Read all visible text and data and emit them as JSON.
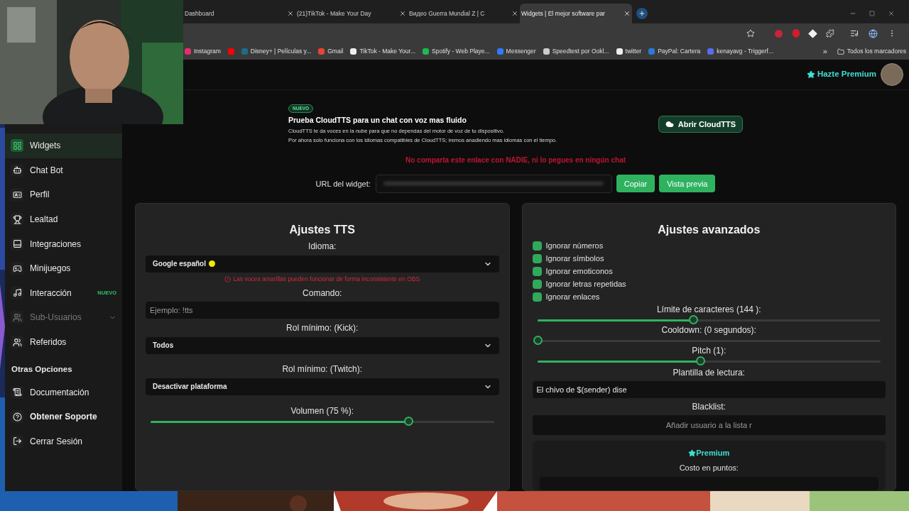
{
  "browser": {
    "tabs": [
      {
        "title": "Dashboard",
        "selected": false
      },
      {
        "title": "(21)TikTok - Make Your Day",
        "selected": false
      },
      {
        "title": "Видео Guerra Mundial Z | С",
        "selected": false
      },
      {
        "title": "Widgets | El mejor software par",
        "selected": true
      }
    ],
    "bookmarks": [
      {
        "label": "Instagram",
        "color": "#e1306c"
      },
      {
        "color": "#ff0000"
      },
      {
        "label": "Disney+ | Películas y...",
        "color": "#1a6e8a"
      },
      {
        "label": "Gmail",
        "color": "#ea4335"
      },
      {
        "label": "TikTok - Make Your...",
        "color": "#eeeeee"
      },
      {
        "label": "Spotify - Web Playe...",
        "color": "#1db954"
      },
      {
        "label": "Messenger",
        "color": "#2f7bff"
      },
      {
        "label": "Speedtest por Ookl...",
        "color": "#cccccc"
      },
      {
        "label": "twitter",
        "color": "#eeeeee"
      },
      {
        "label": "PayPal: Cartera",
        "color": "#2a7ad6"
      },
      {
        "label": "kenayavg - Triggerf...",
        "color": "#5a6cf0"
      }
    ],
    "more": "»",
    "all_bookmarks": "Todos los marcadores"
  },
  "header": {
    "premium": "Hazte Premium"
  },
  "sidebar": {
    "items": [
      {
        "label": "Widgets",
        "selected": true,
        "disabled": false
      },
      {
        "label": "Chat Bot",
        "selected": false,
        "disabled": false
      },
      {
        "label": "Perfil",
        "selected": false,
        "disabled": false
      },
      {
        "label": "Lealtad",
        "selected": false,
        "disabled": false
      },
      {
        "label": "Integraciones",
        "selected": false,
        "disabled": false
      },
      {
        "label": "Minijuegos",
        "selected": false,
        "disabled": false
      },
      {
        "label": "Interacción",
        "selected": false,
        "disabled": false,
        "badge": "NUEVO"
      },
      {
        "label": "Sub-Usuarios",
        "selected": false,
        "disabled": true,
        "expandable": true
      },
      {
        "label": "Referidos",
        "selected": false,
        "disabled": false
      }
    ],
    "section_title": "Otras Opciones",
    "section_items": [
      {
        "label": "Documentación",
        "bold": false
      },
      {
        "label": "Obtener Soporte",
        "bold": true
      },
      {
        "label": "Cerrar Sesión",
        "bold": false
      }
    ]
  },
  "banner": {
    "badge": "NUEVO",
    "title": "Prueba CloudTTS para un chat con voz mas fluido",
    "lines": [
      "CloudTTS te da voces en la nube para que no dependas del motor de voz de tu dispositivo.",
      "Por ahora solo funciona con los idiomas compatibles de CloudTTS; iremos anadiendo mas idiomas con el tiempo."
    ],
    "button": "Abrir CloudTTS"
  },
  "warning": "No comparta este enlace con NADIE, ni lo pegues en ningún chat",
  "url_row": {
    "label": "URL del widget:",
    "buttons": [
      "Copiar",
      "Vista previa"
    ]
  },
  "tts": {
    "title": "Ajustes TTS",
    "fields": [
      {
        "kind": "select",
        "label": "Idioma:",
        "value": "Google español",
        "color": "#f2ea00",
        "note": "Las voces amarillas pueden funcionar de forma inconsistente en OBS"
      },
      {
        "kind": "input",
        "label": "Comando:",
        "placeholder": "Ejemplo: !tts"
      },
      {
        "kind": "select",
        "label": "Rol mínimo: (Kick):",
        "value": "Todos"
      },
      {
        "kind": "select",
        "label": "Rol mínimo: (Twitch):",
        "value": "Desactivar plataforma"
      },
      {
        "kind": "slider",
        "label": "Volumen (75 %):",
        "level": 0.75
      }
    ]
  },
  "advanced": {
    "title": "Ajustes avanzados",
    "checks": [
      {
        "label": "Ignorar números",
        "checked": true
      },
      {
        "label": "Ignorar símbolos",
        "checked": true
      },
      {
        "label": "Ignorar emoticonos",
        "checked": true
      },
      {
        "label": "Ignorar letras repetidas",
        "checked": true
      },
      {
        "label": "Ignorar enlaces",
        "checked": true
      }
    ],
    "fields": [
      {
        "kind": "slider",
        "label": "Límite de caracteres (144 ):",
        "level": 0.454
      },
      {
        "kind": "slider",
        "label": "Cooldown: (0 segundos):",
        "level": 0
      },
      {
        "kind": "slider",
        "label": "Pitch (1):",
        "level": 0.474
      },
      {
        "kind": "input",
        "label": "Plantilla de lectura:",
        "value": "El chivo de $(sender) dise"
      },
      {
        "kind": "input",
        "label": "Blacklist:",
        "placeholder": "Añadir usuario a la lista r",
        "centered": true
      },
      {
        "kind": "premium",
        "title": "Premium",
        "label": "Costo en puntos:"
      }
    ]
  }
}
